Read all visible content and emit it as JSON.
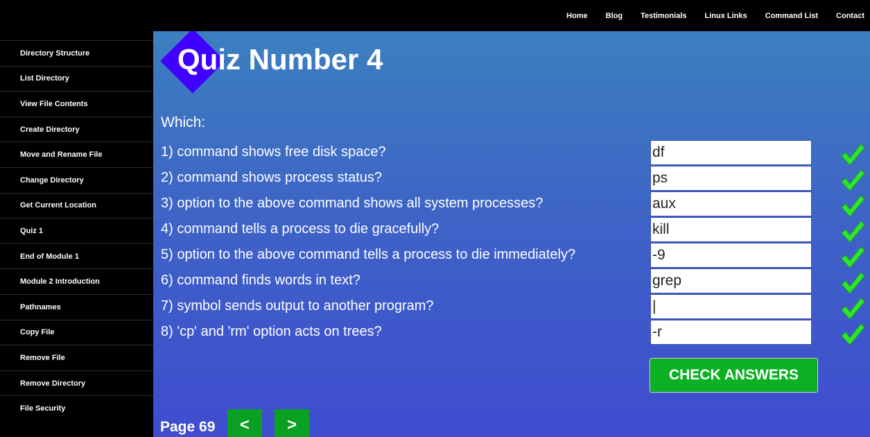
{
  "nav": {
    "items": [
      "Home",
      "Blog",
      "Testimonials",
      "Linux Links",
      "Command List",
      "Contact"
    ]
  },
  "sidebar": {
    "items": [
      "Directory Structure",
      "List Directory",
      "View File Contents",
      "Create Directory",
      "Move and Rename File",
      "Change Directory",
      "Get Current Location",
      "Quiz 1",
      "End of Module 1",
      "Module 2 Introduction",
      "Pathnames",
      "Copy File",
      "Remove File",
      "Remove Directory",
      "File Security"
    ]
  },
  "quiz": {
    "title": "Quiz Number 4",
    "intro": "Which:",
    "questions": [
      {
        "text": "1) command shows free disk space?",
        "answer": "df",
        "status_icon": "check-icon"
      },
      {
        "text": "2) command shows process status?",
        "answer": "ps",
        "status_icon": "check-icon"
      },
      {
        "text": "3) option to the above command shows all system processes?",
        "answer": "aux",
        "status_icon": "check-icon"
      },
      {
        "text": "4) command tells a process to die gracefully?",
        "answer": "kill",
        "status_icon": "check-icon"
      },
      {
        "text": "5) option to the above command tells a process to die immediately?",
        "answer": "-9",
        "status_icon": "check-icon"
      },
      {
        "text": "6) command finds words in text?",
        "answer": "grep",
        "status_icon": "check-icon"
      },
      {
        "text": "7) symbol sends output to another program?",
        "answer": "|",
        "status_icon": "check-icon"
      },
      {
        "text": "8) 'cp' and 'rm' option acts on trees?",
        "answer": "-r",
        "status_icon": "check-icon"
      }
    ],
    "check_label": "CHECK ANSWERS"
  },
  "pager": {
    "page_label": "Page 69",
    "prev_label": "<",
    "next_label": ">"
  },
  "colors": {
    "check_green": "#2ee62e",
    "button_green": "#0bb025",
    "diamond": "#3f00ff"
  }
}
